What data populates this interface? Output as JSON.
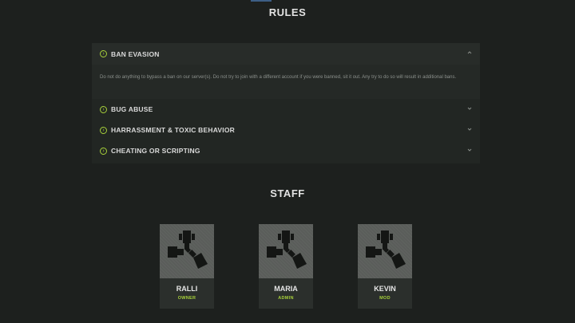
{
  "rules": {
    "title": "RULES",
    "items": [
      {
        "label": "BAN EVASION",
        "open": true,
        "body": "Do not do anything to bypass a ban on our server(s). Do not try to join with a different account if you were banned, sit it out. Any try to do so will result in additional bans."
      },
      {
        "label": "BUG ABUSE",
        "open": false
      },
      {
        "label": "HARRASSMENT & TOXIC BEHAVIOR",
        "open": false
      },
      {
        "label": "CHEATING OR SCRIPTING",
        "open": false
      }
    ]
  },
  "staff": {
    "title": "STAFF",
    "members": [
      {
        "name": "RALLI",
        "role": "OWNER"
      },
      {
        "name": "MARIA",
        "role": "ADMIN"
      },
      {
        "name": "KEVIN",
        "role": "MOD"
      }
    ]
  },
  "colors": {
    "background": "#1d201e",
    "panel": "#222623",
    "accent": "#a6cf3a",
    "text": "#d9d9d9"
  },
  "icons": {
    "expand": "circle-arrow-right-icon",
    "collapse": "chevron-up-icon",
    "expand_chevron": "chevron-down-icon",
    "avatar": "rust-logo-icon"
  }
}
